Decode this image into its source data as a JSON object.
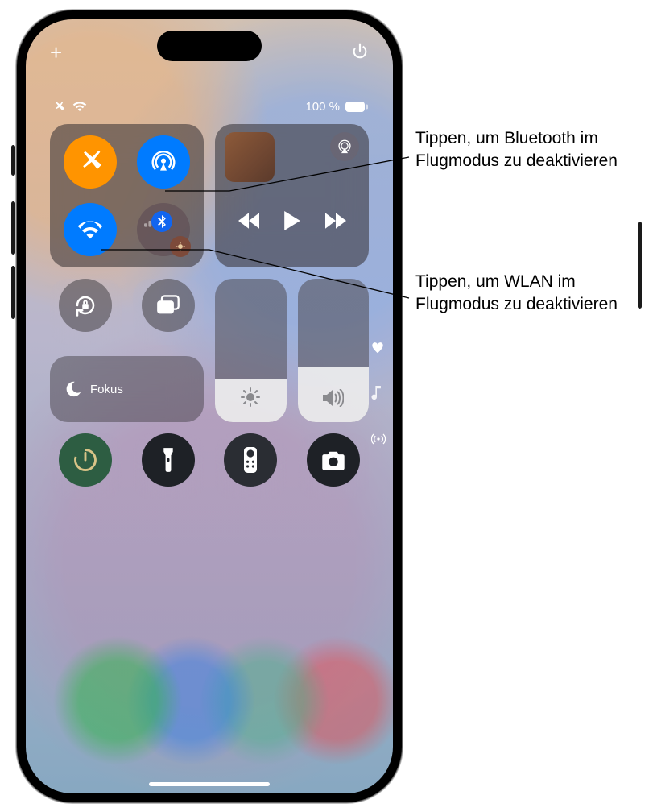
{
  "topbar": {
    "add": "+",
    "power_icon": "power-icon"
  },
  "status": {
    "battery_text": "100 %",
    "airplane_icon": "airplane-mini-icon",
    "wifi_icon": "wifi-mini-icon"
  },
  "connectivity": {
    "airplane": {
      "name": "airplane-mode-button",
      "icon": "airplane-icon",
      "active": true,
      "color": "orange"
    },
    "airdrop": {
      "name": "airdrop-button",
      "icon": "airdrop-icon",
      "active": true,
      "color": "blue"
    },
    "wifi": {
      "name": "wifi-button",
      "icon": "wifi-icon",
      "active": true,
      "color": "blue"
    },
    "cell_bt": {
      "name": "cellular-bluetooth-group",
      "cell_icon": "cellular-icon",
      "bt_icon": "bluetooth-icon",
      "extra_icon": "satellite-icon"
    }
  },
  "media": {
    "title": "- -",
    "airplay_icon": "airplay-icon",
    "prev_icon": "rewind-icon",
    "play_icon": "play-icon",
    "next_icon": "forward-icon"
  },
  "controls": {
    "lock_rotation": {
      "name": "orientation-lock-button",
      "icon": "rotation-lock-icon"
    },
    "mirroring": {
      "name": "screen-mirroring-button",
      "icon": "screen-mirroring-icon"
    },
    "focus": {
      "name": "focus-button",
      "icon": "moon-icon",
      "label": "Fokus"
    },
    "brightness": {
      "name": "brightness-slider",
      "icon": "sun-icon",
      "level_pct": 30
    },
    "volume": {
      "name": "volume-slider",
      "icon": "speaker-icon",
      "level_pct": 38
    },
    "rail": {
      "favorite_icon": "heart-icon",
      "music_icon": "music-note-icon",
      "broadcast_icon": "broadcast-icon"
    },
    "row": {
      "timer": {
        "name": "timer-button",
        "icon": "timer-icon"
      },
      "flash": {
        "name": "flashlight-button",
        "icon": "flashlight-icon"
      },
      "remote": {
        "name": "apple-tv-remote-button",
        "icon": "remote-icon"
      },
      "camera": {
        "name": "camera-button",
        "icon": "camera-icon"
      }
    }
  },
  "callouts": {
    "bluetooth": "Tippen, um Bluetooth im Flugmodus zu deaktivieren",
    "wlan": "Tippen, um WLAN im Flugmodus zu deaktivieren"
  },
  "colors": {
    "orange": "#ff9500",
    "blue": "#007aff"
  }
}
